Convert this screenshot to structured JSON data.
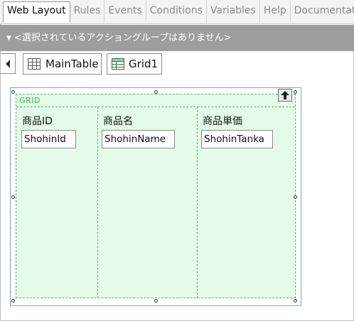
{
  "tabs": [
    {
      "label": "Web Layout",
      "active": true
    },
    {
      "label": "Rules",
      "active": false
    },
    {
      "label": "Events",
      "active": false
    },
    {
      "label": "Conditions",
      "active": false
    },
    {
      "label": "Variables",
      "active": false
    },
    {
      "label": "Help",
      "active": false
    },
    {
      "label": "Documentation",
      "active": false
    }
  ],
  "action_group_bar": {
    "text": "<選択されているアクショングループはありません>",
    "icon": "collapse-triangle-icon"
  },
  "breadcrumb": {
    "back_icon": "back-arrow-icon",
    "items": [
      {
        "label": "MainTable",
        "icon": "table-icon"
      },
      {
        "label": "Grid1",
        "icon": "grid-icon"
      }
    ]
  },
  "grid": {
    "title": "GRID",
    "columns": [
      {
        "title": "商品ID",
        "field": "ShohinId"
      },
      {
        "title": "商品名",
        "field": "ShohinName"
      },
      {
        "title": "商品単価",
        "field": "ShohinTanka"
      }
    ]
  },
  "colors": {
    "grid_background": "#e3fbe8",
    "grid_border": "#5db371",
    "selection_border": "#7e9fd1",
    "group_bar": "#9e9e9e"
  }
}
